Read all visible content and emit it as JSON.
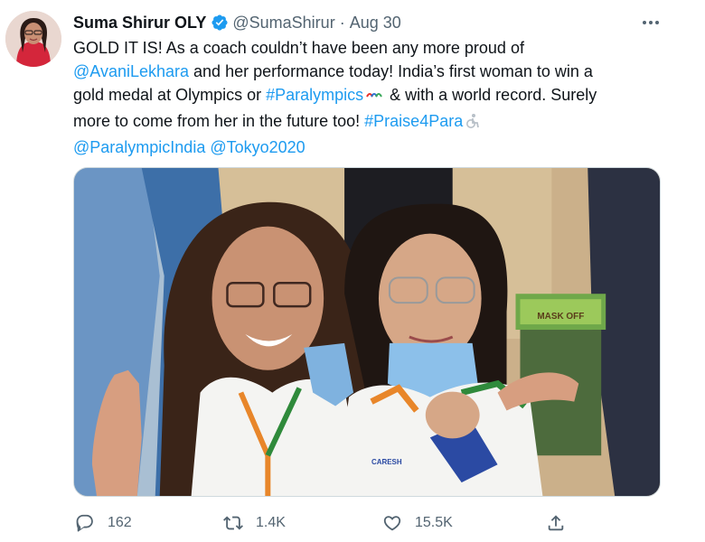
{
  "author": {
    "name": "Suma Shirur OLY",
    "handle": "@SumaShirur",
    "separator": "·",
    "time": "Aug 30",
    "verified": true
  },
  "tweet_text": {
    "l1": "GOLD IT IS! As a coach couldn’t have been any more proud of",
    "l2_mention": "@AvaniLekhara",
    "l2_rest": " and her performance today! India’s first woman to win a",
    "l3_a": "gold medal at Olympics or ",
    "l3_hashtag": "#Paralympics",
    "l3_b": " & with a world record. Surely",
    "l4_a": "more to come from her in the future too! ",
    "l4_hashtag": "#Praise4Para",
    "l5_mention1": "@ParalympicIndia",
    "l5_mention2": "@Tokyo2020"
  },
  "photo": {
    "sign_text": "MASK OFF",
    "shirt_text": "CARESH"
  },
  "actions": {
    "reply_count": "162",
    "retweet_count": "1.4K",
    "like_count": "15.5K"
  },
  "icons": {
    "verified": "verified-badge-icon",
    "more": "more-icon",
    "reply": "reply-icon",
    "retweet": "retweet-icon",
    "like": "heart-icon",
    "share": "share-icon"
  },
  "colors": {
    "link": "#1d9bf0",
    "secondary_text": "#536471",
    "verified": "#1d9bf0"
  }
}
